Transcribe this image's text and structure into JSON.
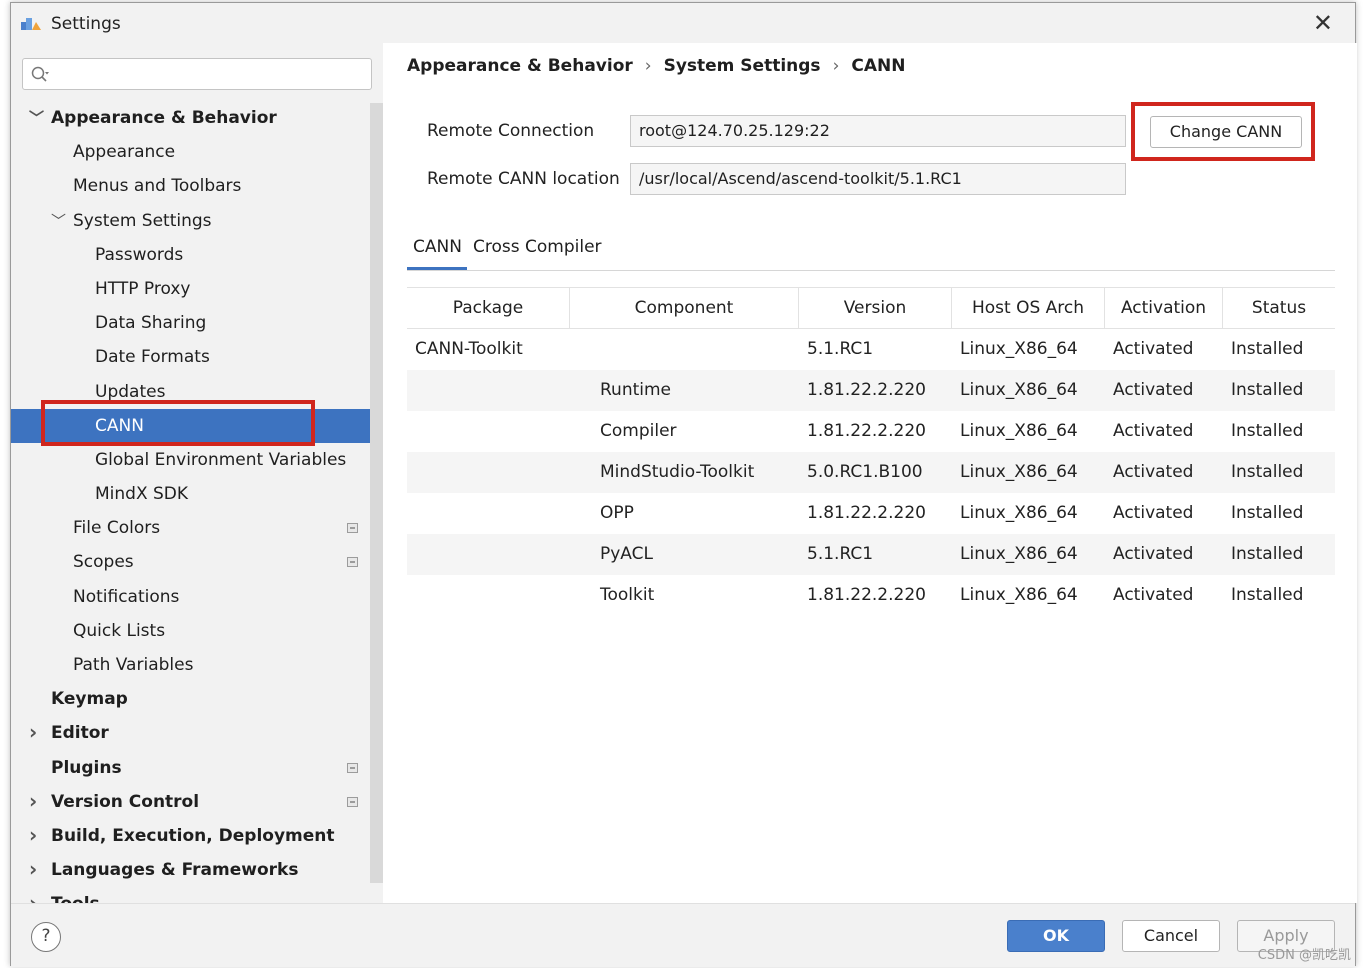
{
  "window": {
    "title": "Settings"
  },
  "search": {
    "placeholder": ""
  },
  "sidebar": {
    "items": [
      {
        "label": "Appearance & Behavior",
        "bold": true,
        "chevron": "expanded",
        "level": 0
      },
      {
        "label": "Appearance",
        "bold": false,
        "chevron": "none",
        "level": 1
      },
      {
        "label": "Menus and Toolbars",
        "bold": false,
        "chevron": "none",
        "level": 1
      },
      {
        "label": "System Settings",
        "bold": false,
        "chevron": "expanded",
        "level": 1
      },
      {
        "label": "Passwords",
        "bold": false,
        "chevron": "none",
        "level": 2
      },
      {
        "label": "HTTP Proxy",
        "bold": false,
        "chevron": "none",
        "level": 2
      },
      {
        "label": "Data Sharing",
        "bold": false,
        "chevron": "none",
        "level": 2
      },
      {
        "label": "Date Formats",
        "bold": false,
        "chevron": "none",
        "level": 2
      },
      {
        "label": "Updates",
        "bold": false,
        "chevron": "none",
        "level": 2
      },
      {
        "label": "CANN",
        "bold": false,
        "chevron": "none",
        "level": 2,
        "selected": true
      },
      {
        "label": "Global Environment Variables",
        "bold": false,
        "chevron": "none",
        "level": 2
      },
      {
        "label": "MindX SDK",
        "bold": false,
        "chevron": "none",
        "level": 2
      },
      {
        "label": "File Colors",
        "bold": false,
        "chevron": "none",
        "level": 1,
        "project_icon": true
      },
      {
        "label": "Scopes",
        "bold": false,
        "chevron": "none",
        "level": 1,
        "project_icon": true
      },
      {
        "label": "Notifications",
        "bold": false,
        "chevron": "none",
        "level": 1
      },
      {
        "label": "Quick Lists",
        "bold": false,
        "chevron": "none",
        "level": 1
      },
      {
        "label": "Path Variables",
        "bold": false,
        "chevron": "none",
        "level": 1
      },
      {
        "label": "Keymap",
        "bold": true,
        "chevron": "none",
        "level": 0
      },
      {
        "label": "Editor",
        "bold": true,
        "chevron": "collapsed",
        "level": 0
      },
      {
        "label": "Plugins",
        "bold": true,
        "chevron": "none",
        "level": 0,
        "project_icon": true
      },
      {
        "label": "Version Control",
        "bold": true,
        "chevron": "collapsed",
        "level": 0,
        "project_icon": true
      },
      {
        "label": "Build, Execution, Deployment",
        "bold": true,
        "chevron": "collapsed",
        "level": 0
      },
      {
        "label": "Languages & Frameworks",
        "bold": true,
        "chevron": "collapsed",
        "level": 0
      },
      {
        "label": "Tools",
        "bold": true,
        "chevron": "collapsed",
        "level": 0
      }
    ]
  },
  "breadcrumb": [
    "Appearance & Behavior",
    "System Settings",
    "CANN"
  ],
  "breadcrumb_separator": "›",
  "remote": {
    "connection_label": "Remote Connection",
    "connection_value": "root@124.70.25.129:22",
    "location_label": "Remote CANN location",
    "location_value": "/usr/local/Ascend/ascend-toolkit/5.1.RC1",
    "change_button": "Change CANN"
  },
  "tabs": [
    {
      "label": "CANN",
      "active": true
    },
    {
      "label": "Cross Compiler",
      "active": false
    }
  ],
  "table": {
    "columns": [
      "Package",
      "Component",
      "Version",
      "Host OS Arch",
      "Activation",
      "Status"
    ],
    "rows": [
      [
        "CANN-Toolkit",
        "",
        "5.1.RC1",
        "Linux_X86_64",
        "Activated",
        "Installed"
      ],
      [
        "",
        "Runtime",
        "1.81.22.2.220",
        "Linux_X86_64",
        "Activated",
        "Installed"
      ],
      [
        "",
        "Compiler",
        "1.81.22.2.220",
        "Linux_X86_64",
        "Activated",
        "Installed"
      ],
      [
        "",
        "MindStudio-Toolkit",
        "5.0.RC1.B100",
        "Linux_X86_64",
        "Activated",
        "Installed"
      ],
      [
        "",
        "OPP",
        "1.81.22.2.220",
        "Linux_X86_64",
        "Activated",
        "Installed"
      ],
      [
        "",
        "PyACL",
        "5.1.RC1",
        "Linux_X86_64",
        "Activated",
        "Installed"
      ],
      [
        "",
        "Toolkit",
        "1.81.22.2.220",
        "Linux_X86_64",
        "Activated",
        "Installed"
      ]
    ]
  },
  "footer": {
    "help": "?",
    "ok": "OK",
    "cancel": "Cancel",
    "apply": "Apply",
    "watermark": "CSDN @凯吃凯"
  },
  "colors": {
    "selection": "#3d73c0",
    "highlight_box": "#d0261d",
    "ok_button": "#4a80cc"
  },
  "icons": {
    "app": "intellij-app-icon",
    "close": "close-icon",
    "search": "search-icon",
    "expanded": "chevron-down-icon",
    "collapsed": "chevron-right-icon",
    "project": "project-level-icon",
    "help": "help-icon"
  }
}
